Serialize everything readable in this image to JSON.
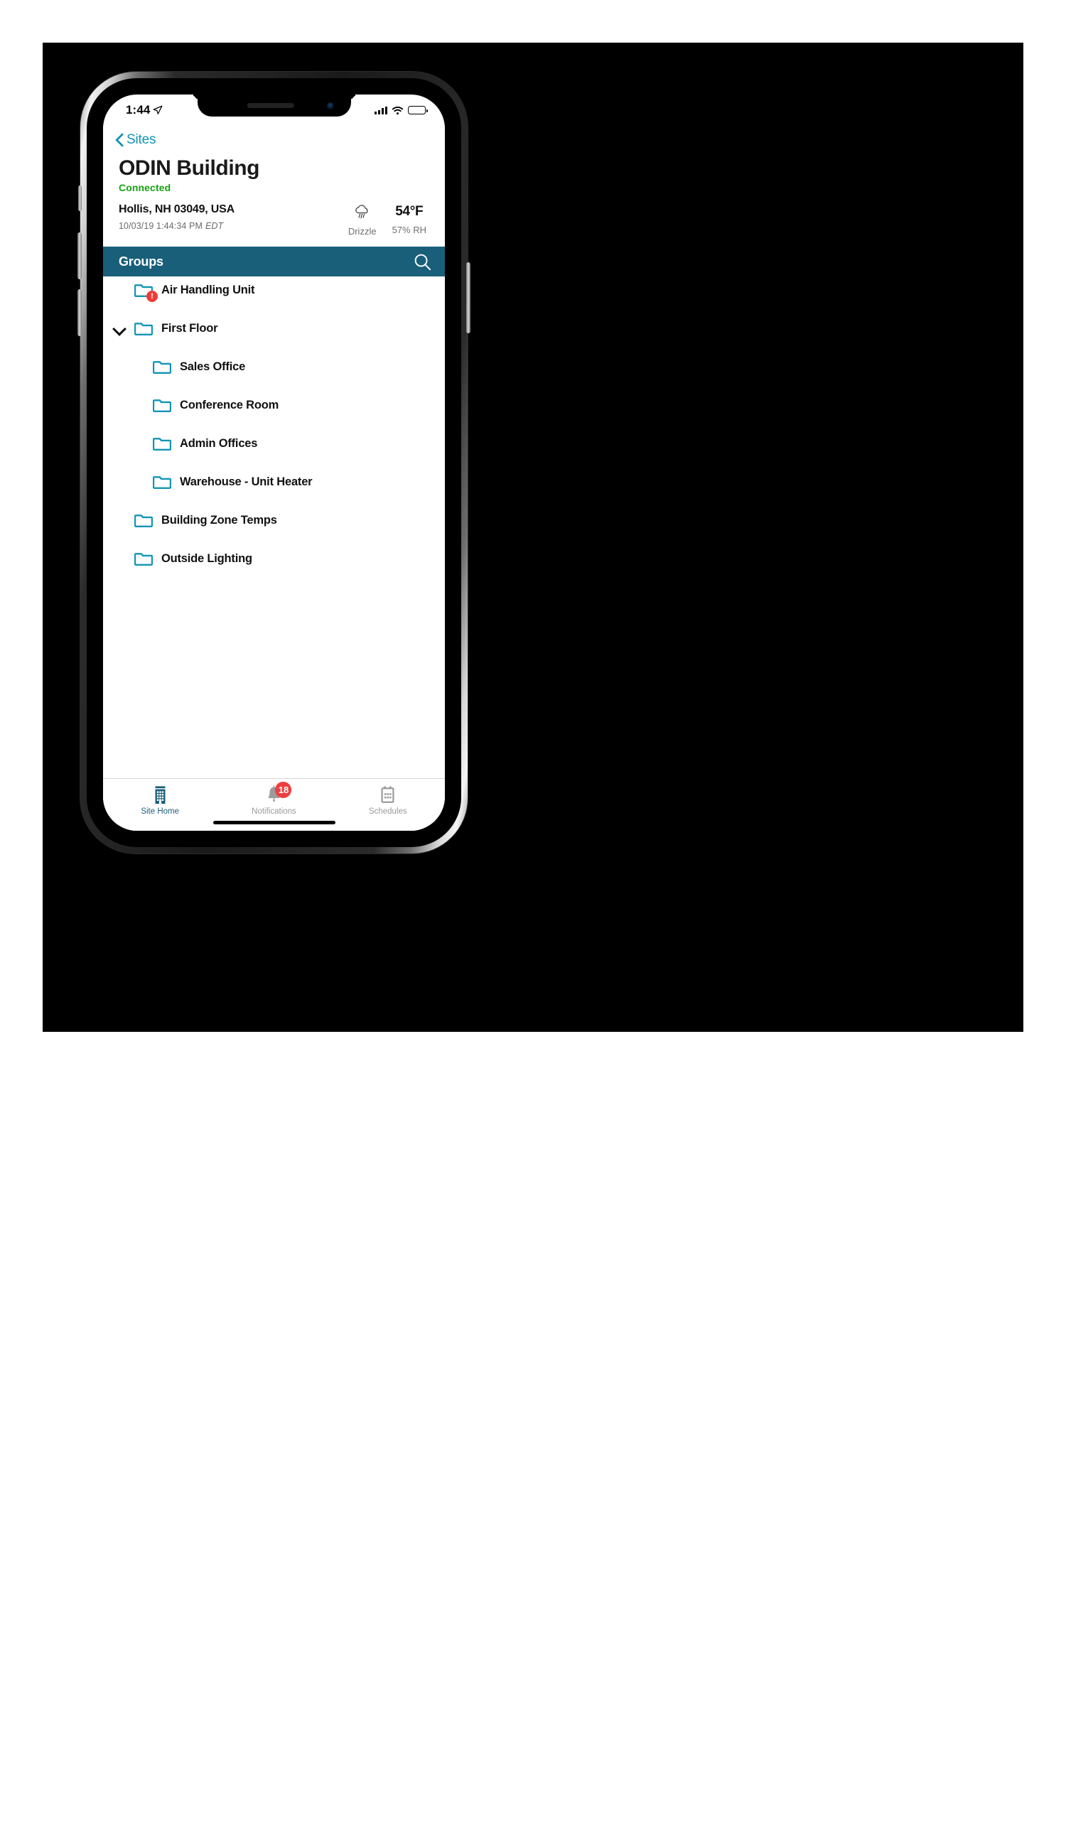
{
  "status_bar": {
    "time": "1:44",
    "location_icon": "location-arrow-icon",
    "signal_icon": "cellular-bars-icon",
    "wifi_icon": "wifi-icon",
    "battery_icon": "battery-icon",
    "battery_level_pct": 42
  },
  "nav": {
    "back_label": "Sites",
    "back_icon": "chevron-left-icon"
  },
  "site": {
    "title": "ODIN Building",
    "connection_status": "Connected",
    "connection_color": "#16a312",
    "address": "Hollis, NH 03049, USA",
    "timestamp": "10/03/19 1:44:34 PM",
    "timezone": "EDT"
  },
  "weather": {
    "icon": "drizzle-cloud-icon",
    "condition": "Drizzle",
    "temperature": "54°F",
    "humidity": "57% RH"
  },
  "groups_header": {
    "title": "Groups",
    "search_icon": "search-icon",
    "background_color": "#1a5f7a"
  },
  "groups": [
    {
      "label": "Air Handling Unit",
      "level": 0,
      "chevron": "none",
      "alert": true,
      "alert_symbol": "!"
    },
    {
      "label": "First Floor",
      "level": 0,
      "chevron": "down",
      "alert": false
    },
    {
      "label": "Sales Office",
      "level": 1,
      "chevron": "none",
      "alert": false
    },
    {
      "label": "Conference Room",
      "level": 1,
      "chevron": "none",
      "alert": false
    },
    {
      "label": "Admin Offices",
      "level": 1,
      "chevron": "none",
      "alert": false
    },
    {
      "label": "Warehouse - Unit Heater",
      "level": 1,
      "chevron": "none",
      "alert": false
    },
    {
      "label": "Building Zone Temps",
      "level": 0,
      "chevron": "none",
      "alert": false
    },
    {
      "label": "Outside Lighting",
      "level": 0,
      "chevron": "none",
      "alert": false
    }
  ],
  "folder_color": "#1295b5",
  "tabs": [
    {
      "label": "Site Home",
      "icon": "building-icon",
      "active": true,
      "badge": null
    },
    {
      "label": "Notifications",
      "icon": "bell-icon",
      "active": false,
      "badge": "18"
    },
    {
      "label": "Schedules",
      "icon": "calendar-icon",
      "active": false,
      "badge": null
    }
  ]
}
